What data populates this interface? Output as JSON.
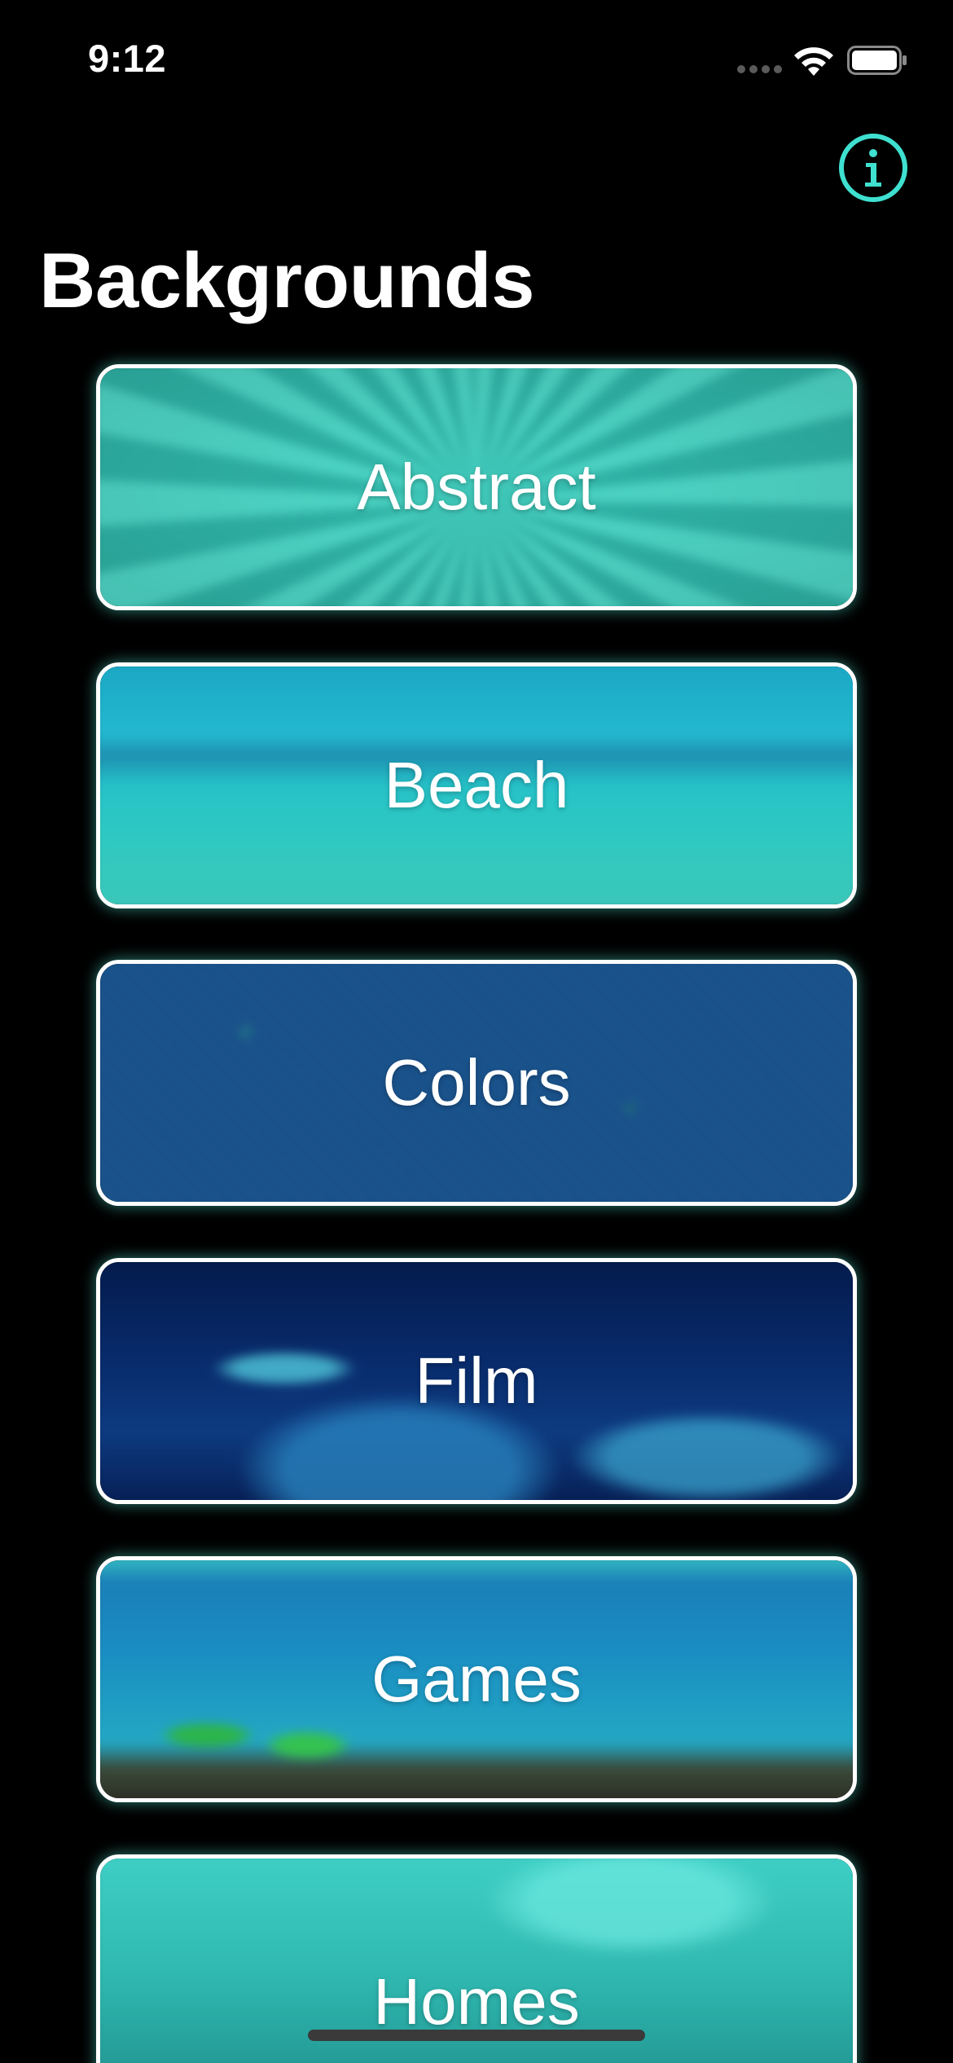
{
  "status_bar": {
    "time": "9:12"
  },
  "header": {
    "title": "Backgrounds",
    "info_icon": "info-icon"
  },
  "categories": [
    {
      "label": "Abstract"
    },
    {
      "label": "Beach"
    },
    {
      "label": "Colors"
    },
    {
      "label": "Film"
    },
    {
      "label": "Games"
    },
    {
      "label": "Homes"
    }
  ],
  "colors": {
    "accent": "#3fe0d0",
    "background": "#000000",
    "card_border": "#ffffff"
  }
}
